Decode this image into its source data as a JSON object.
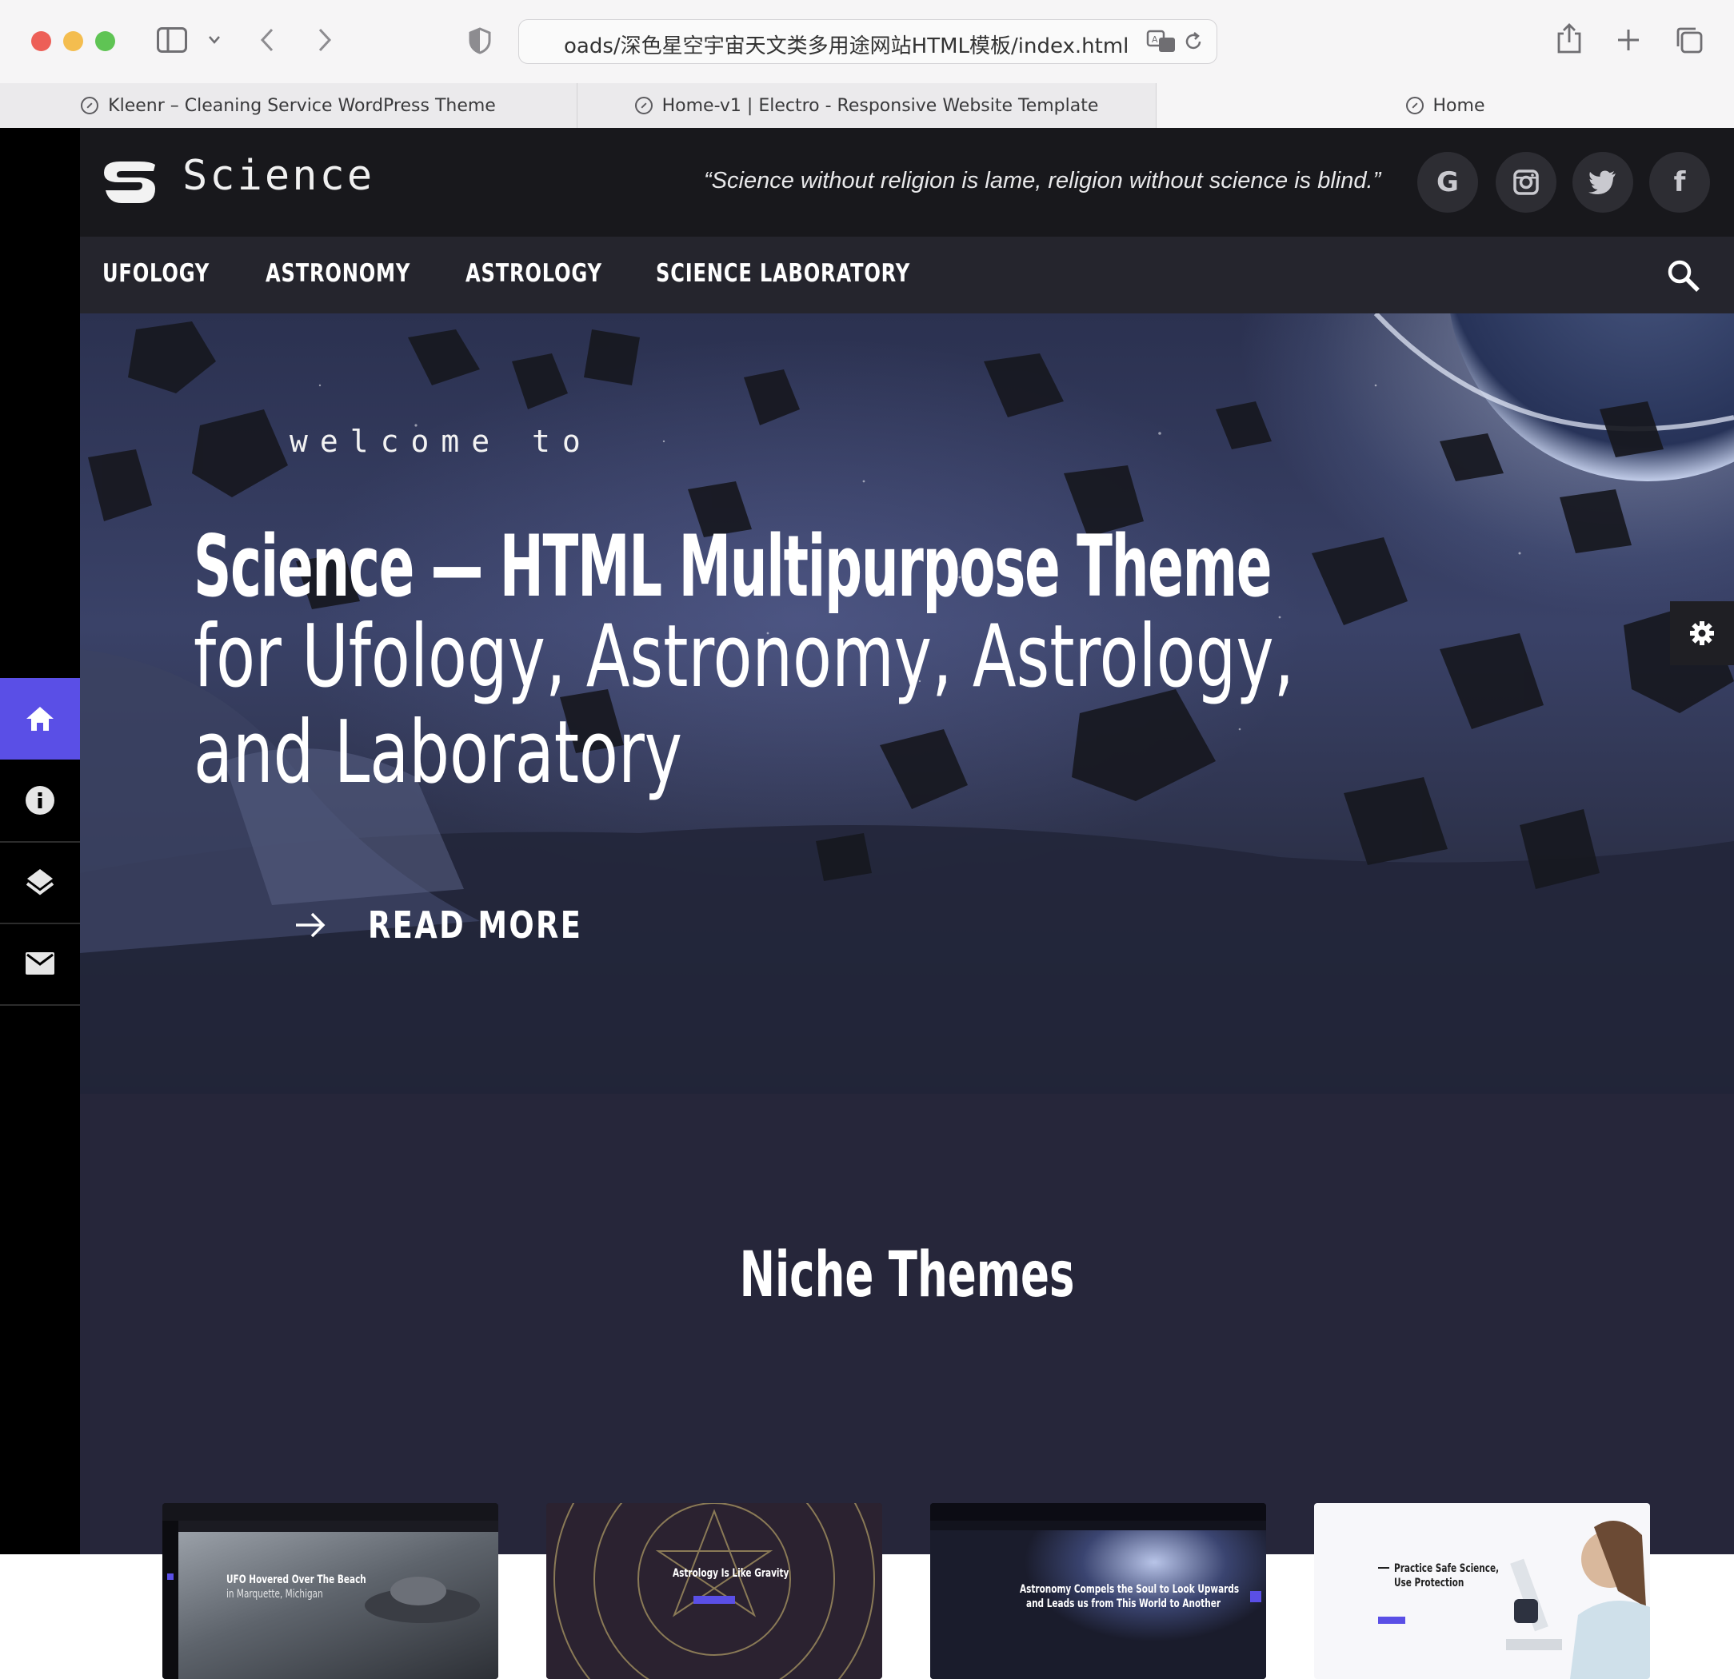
{
  "browser": {
    "address": "oads/深色星空宇宙天文类多用途网站HTML模板/index.html",
    "tabs": [
      {
        "label": "Kleenr – Cleaning Service WordPress Theme"
      },
      {
        "label": "Home-v1 | Electro - Responsive Website Template"
      },
      {
        "label": "Home"
      }
    ]
  },
  "site": {
    "logo": "Science",
    "quote": "“Science without religion is lame, religion without science is blind.”",
    "social": [
      "G",
      "f"
    ],
    "nav": [
      "UFOLOGY",
      "ASTRONOMY",
      "ASTROLOGY",
      "SCIENCE LABORATORY"
    ],
    "hero": {
      "welcome": "welcome to",
      "title": "Science — HTML Multipurpose Theme",
      "subtitle": "for Ufology, Astronomy, Astrology, and Laboratory",
      "cta": "READ MORE"
    },
    "niche": {
      "title": "Niche Themes",
      "thumbs": [
        {
          "caption": "UFO Hovered Over The Beach",
          "caption2": "in Marquette, Michigan"
        },
        {
          "caption": "Astrology Is Like Gravity"
        },
        {
          "caption": "Astronomy Compels the Soul to Look Upwards",
          "caption2": "and Leads us from This World to Another"
        },
        {
          "caption": "Practice Safe Science,",
          "caption2": "Use Protection"
        }
      ]
    }
  },
  "colors": {
    "accent": "#5a4fe6",
    "header": "#18181c",
    "nav": "#25252d",
    "section": "#26263a"
  }
}
